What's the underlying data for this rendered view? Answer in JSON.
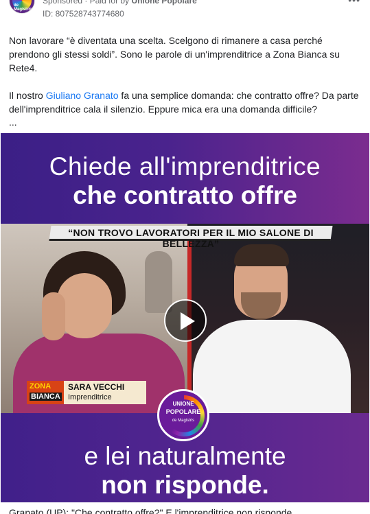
{
  "ad": {
    "sponsored_label": "Sponsored",
    "paid_by_text": "· Paid for by",
    "advertiser": "Unione Popolare",
    "library_id": "ID: 807528743774680",
    "more_icon": "more-horizontal-icon"
  },
  "post": {
    "paragraph1": "Non lavorare “è diventata una scelta. Scelgono di rimanere a casa perché prendono gli stessi soldi”. Sono le parole di un'imprenditrice a Zona Bianca su Rete4.",
    "paragraph2_before": "Il nostro ",
    "paragraph2_link": "Giuliano Granato",
    "paragraph2_after": " fa una semplice domanda: che contratto offre? Da parte dell'imprenditrice cala il silenzio. Eppure mica era una domanda difficile?",
    "ellipsis": "..."
  },
  "video": {
    "top_line1": "Chiede all'imprenditrice",
    "top_line2": "che contratto offre",
    "banner": "“NON TROVO LAVORATORI PER IL MIO SALONE DI BELLEZZA”",
    "show_line1": "ZONA",
    "show_line2": "BIANCA",
    "guest_name": "SARA VECCHI",
    "guest_role": "Imprenditrice",
    "logo_line1": "UNIONE",
    "logo_line2": "POPOLARE",
    "logo_line3": "de Magistris",
    "bottom_line1": "e lei naturalmente",
    "bottom_line2": "non risponde.",
    "play_icon": "play-icon"
  },
  "caption": "Granato (UP): \"Che contratto offre?\" E l'imprenditrice non risponde"
}
